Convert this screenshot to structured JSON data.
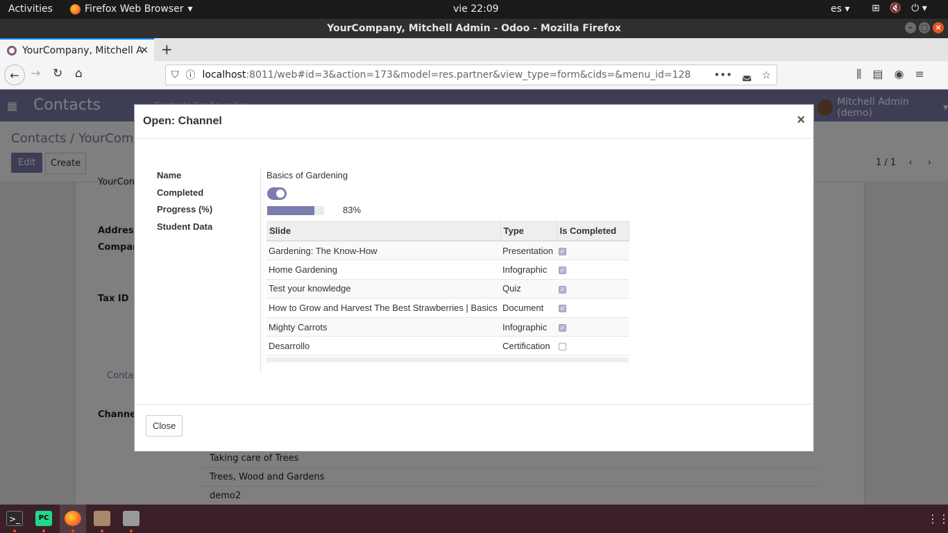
{
  "system": {
    "activities": "Activities",
    "app_menu": "Firefox Web Browser",
    "clock": "vie 22:09",
    "lang": "es"
  },
  "browser": {
    "window_title": "YourCompany, Mitchell Admin - Odoo - Mozilla Firefox",
    "tab_title": "YourCompany, Mitchell A",
    "url_host": "localhost",
    "url_rest": ":8011/web#id=3&action=173&model=res.partner&view_type=form&cids=&menu_id=128"
  },
  "odoo": {
    "app_name": "Contacts",
    "menu_items": "Contacts    Configuration",
    "user": "Mitchell Admin (demo)",
    "breadcrumb_root": "Contacts",
    "breadcrumb_sep": "/",
    "breadcrumb_current": "YourCompa",
    "edit_label": "Edit",
    "create_label": "Create",
    "pager": "1 / 1",
    "sheet": {
      "company_stub": "YourCom",
      "address_label": "Address",
      "company_label": "Company",
      "tax_label": "Tax ID",
      "tab_label": "Contac",
      "channel_label": "Channel",
      "channels": [
        "Taking care of Trees",
        "Trees, Wood and Gardens",
        "demo2"
      ]
    }
  },
  "modal": {
    "title": "Open: Channel",
    "close_x": "×",
    "fields": {
      "name_label": "Name",
      "name_value": "Basics of Gardening",
      "completed_label": "Completed",
      "completed": true,
      "progress_label": "Progress (%)",
      "progress_value": 83,
      "progress_text": "83%",
      "student_label": "Student Data"
    },
    "table": {
      "headers": [
        "Slide",
        "Type",
        "Is Completed"
      ],
      "rows": [
        {
          "slide": "Gardening: The Know-How",
          "type": "Presentation",
          "done": true
        },
        {
          "slide": "Home Gardening",
          "type": "Infographic",
          "done": true
        },
        {
          "slide": "Test your knowledge",
          "type": "Quiz",
          "done": true
        },
        {
          "slide": "How to Grow and Harvest The Best Strawberries | Basics",
          "type": "Document",
          "done": true
        },
        {
          "slide": "Mighty Carrots",
          "type": "Infographic",
          "done": true
        },
        {
          "slide": "Desarrollo",
          "type": "Certification",
          "done": false
        }
      ]
    },
    "close_button": "Close"
  },
  "colors": {
    "brand": "#7c7bad",
    "overlay": "rgba(0,0,0,0.5)"
  }
}
